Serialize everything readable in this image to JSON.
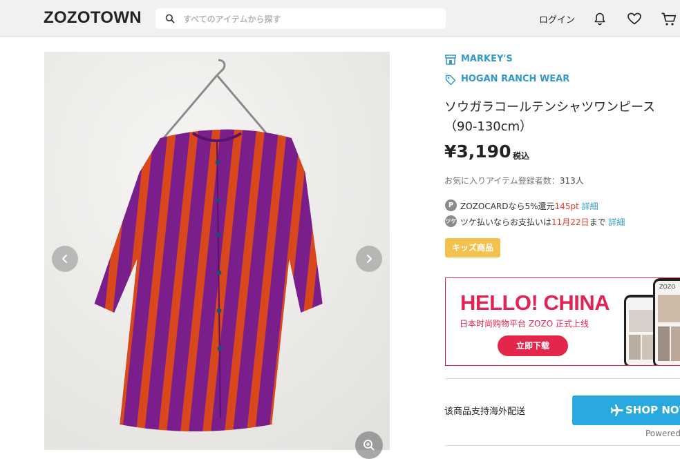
{
  "header": {
    "logo": "ZOZOTOWN",
    "search_placeholder": "すべてのアイテムから探す",
    "login_label": "ログイン",
    "icons": [
      "search-icon",
      "bell-icon",
      "heart-icon",
      "cart-icon"
    ]
  },
  "product": {
    "shop_name": "MARKEY'S",
    "brand_name": "HOGAN RANCH WEAR",
    "title": "ソウガラコールテンシャツワンピース（90-130cm）",
    "price": "¥3,190",
    "tax_label": "税込",
    "favorites_label": "お気に入りアイテム登録者数：",
    "favorites_count": "313人",
    "points": {
      "icon_text": "P",
      "prefix": "ZOZOCARDなら5%還元",
      "value": "145pt",
      "link": "詳細"
    },
    "tsuke": {
      "icon_text": "ツケ",
      "prefix": "ツケ払いならお支払いは",
      "date": "11月22日",
      "suffix": "まで",
      "link": "詳細"
    },
    "badge": "キッズ商品"
  },
  "banner": {
    "headline": "HELLO! CHINA",
    "subtitle": "日本时尚购物平台 ZOZO 正式上线",
    "button": "立即下载",
    "phone_brand": "ZOZO"
  },
  "overseas": {
    "text": "该商品支持海外配送",
    "button_label": "SHOP NOW",
    "powered_label": "Powered"
  },
  "colors": {
    "link_blue": "#3498c9",
    "accent_red": "#e23b2f",
    "badge_yellow": "#f2c14e",
    "banner_pink": "#e02453",
    "shopnow_blue": "#29a9e0"
  }
}
